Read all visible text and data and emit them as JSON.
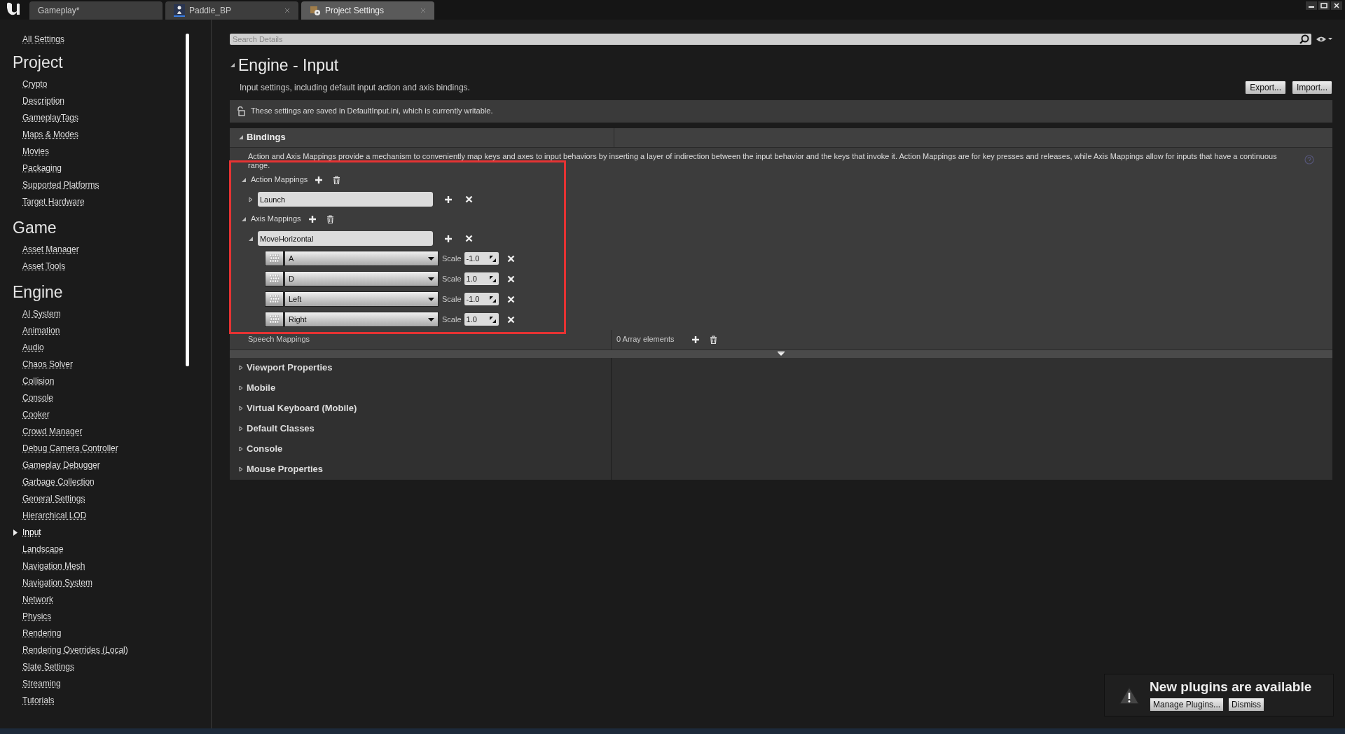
{
  "tabs": [
    {
      "label": "Gameplay*",
      "selected": false,
      "closable": false,
      "kind": "level"
    },
    {
      "label": "Paddle_BP",
      "selected": false,
      "closable": true,
      "kind": "blueprint"
    },
    {
      "label": "Project Settings",
      "selected": true,
      "closable": true,
      "kind": "settings"
    }
  ],
  "sidebar": {
    "top_link": "All Settings",
    "sections": [
      {
        "heading": "Project",
        "items": [
          {
            "label": "Crypto",
            "selected": false
          },
          {
            "label": "Description",
            "selected": false
          },
          {
            "label": "GameplayTags",
            "selected": false
          },
          {
            "label": "Maps & Modes",
            "selected": false
          },
          {
            "label": "Movies",
            "selected": false
          },
          {
            "label": "Packaging",
            "selected": false
          },
          {
            "label": "Supported Platforms",
            "selected": false
          },
          {
            "label": "Target Hardware",
            "selected": false
          }
        ]
      },
      {
        "heading": "Game",
        "items": [
          {
            "label": "Asset Manager",
            "selected": false
          },
          {
            "label": "Asset Tools",
            "selected": false
          }
        ]
      },
      {
        "heading": "Engine",
        "items": [
          {
            "label": "AI System",
            "selected": false
          },
          {
            "label": "Animation",
            "selected": false
          },
          {
            "label": "Audio",
            "selected": false
          },
          {
            "label": "Chaos Solver",
            "selected": false
          },
          {
            "label": "Collision",
            "selected": false
          },
          {
            "label": "Console",
            "selected": false
          },
          {
            "label": "Cooker",
            "selected": false
          },
          {
            "label": "Crowd Manager",
            "selected": false
          },
          {
            "label": "Debug Camera Controller",
            "selected": false
          },
          {
            "label": "Gameplay Debugger",
            "selected": false
          },
          {
            "label": "Garbage Collection",
            "selected": false
          },
          {
            "label": "General Settings",
            "selected": false
          },
          {
            "label": "Hierarchical LOD",
            "selected": false
          },
          {
            "label": "Input",
            "selected": true
          },
          {
            "label": "Landscape",
            "selected": false
          },
          {
            "label": "Navigation Mesh",
            "selected": false
          },
          {
            "label": "Navigation System",
            "selected": false
          },
          {
            "label": "Network",
            "selected": false
          },
          {
            "label": "Physics",
            "selected": false
          },
          {
            "label": "Rendering",
            "selected": false
          },
          {
            "label": "Rendering Overrides (Local)",
            "selected": false
          },
          {
            "label": "Slate Settings",
            "selected": false
          },
          {
            "label": "Streaming",
            "selected": false
          },
          {
            "label": "Tutorials",
            "selected": false
          }
        ]
      }
    ]
  },
  "search": {
    "placeholder": "Search Details"
  },
  "page": {
    "title": "Engine - Input",
    "subtitle": "Input settings, including default input action and axis bindings.",
    "buttons": [
      "Export...",
      "Import..."
    ],
    "info": "These settings are saved in DefaultInput.ini, which is currently writable."
  },
  "bindings": {
    "title": "Bindings",
    "expanded": true,
    "description": "Action and Axis Mappings provide a mechanism to conveniently map keys and axes to input behaviors by inserting a layer of indirection between the input behavior and the keys that invoke it. Action Mappings are for key presses and releases, while Axis Mappings allow for inputs that have a continuous range.",
    "action_mappings": {
      "label": "Action Mappings",
      "expanded": true,
      "items": [
        {
          "name": "Launch",
          "expanded": false
        }
      ]
    },
    "axis_mappings": {
      "label": "Axis Mappings",
      "expanded": true,
      "items": [
        {
          "name": "MoveHorizontal",
          "expanded": true,
          "keys": [
            {
              "key": "A",
              "scale_label": "Scale",
              "scale": "-1.0"
            },
            {
              "key": "D",
              "scale_label": "Scale",
              "scale": "1.0"
            },
            {
              "key": "Left",
              "scale_label": "Scale",
              "scale": "-1.0"
            },
            {
              "key": "Right",
              "scale_label": "Scale",
              "scale": "1.0"
            }
          ]
        }
      ]
    },
    "speech_mappings": {
      "label": "Speech Mappings",
      "count": "0 Array elements"
    }
  },
  "categories": [
    {
      "label": "Viewport Properties",
      "expanded": false
    },
    {
      "label": "Mobile",
      "expanded": false
    },
    {
      "label": "Virtual Keyboard (Mobile)",
      "expanded": false
    },
    {
      "label": "Default Classes",
      "expanded": false
    },
    {
      "label": "Console",
      "expanded": false
    },
    {
      "label": "Mouse Properties",
      "expanded": false
    }
  ],
  "notification": {
    "message": "New plugins are available",
    "buttons": [
      "Manage Plugins...",
      "Dismiss"
    ]
  }
}
